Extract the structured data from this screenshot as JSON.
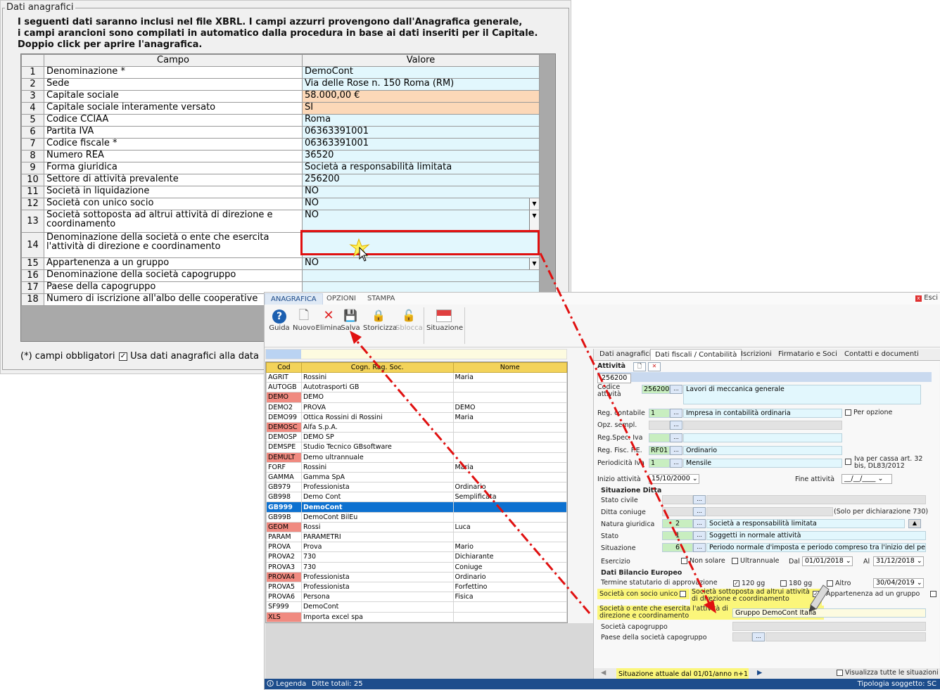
{
  "back": {
    "legend": "Dati anagrafici",
    "intro": [
      "I seguenti dati saranno inclusi nel file XBRL. I campi azzurri provengono dall'Anagrafica generale,",
      "i campi arancioni sono compilati in automatico dalla procedura in base ai dati inseriti per il Capitale.",
      "Doppio click per aprire l'anagrafica."
    ],
    "headers": {
      "campo": "Campo",
      "valore": "Valore"
    },
    "rows": [
      {
        "n": "1",
        "campo": "Denominazione *",
        "valore": "DemoCont"
      },
      {
        "n": "2",
        "campo": "Sede",
        "valore": "Via delle Rose n. 150 Roma (RM)"
      },
      {
        "n": "3",
        "campo": "Capitale sociale",
        "valore": "58.000,00 €"
      },
      {
        "n": "4",
        "campo": "Capitale sociale interamente versato",
        "valore": "SI"
      },
      {
        "n": "5",
        "campo": "Codice CCIAA",
        "valore": "Roma"
      },
      {
        "n": "6",
        "campo": "Partita IVA",
        "valore": "06363391001"
      },
      {
        "n": "7",
        "campo": "Codice fiscale *",
        "valore": "06363391001"
      },
      {
        "n": "8",
        "campo": "Numero REA",
        "valore": "36520"
      },
      {
        "n": "9",
        "campo": "Forma giuridica",
        "valore": "Società a responsabilità limitata"
      },
      {
        "n": "10",
        "campo": "Settore di attività prevalente",
        "valore": "256200"
      },
      {
        "n": "11",
        "campo": "Società in liquidazione",
        "valore": "NO"
      },
      {
        "n": "12",
        "campo": "Società con unico socio",
        "valore": "NO"
      },
      {
        "n": "13",
        "campo": "Società sottoposta ad altrui attività di direzione e coordinamento",
        "valore": "NO"
      },
      {
        "n": "14",
        "campo": "Denominazione della società o ente che esercita l'attività di direzione e coordinamento",
        "valore": ""
      },
      {
        "n": "15",
        "campo": "Appartenenza a un gruppo",
        "valore": "NO"
      },
      {
        "n": "16",
        "campo": "Denominazione della società capogruppo",
        "valore": ""
      },
      {
        "n": "17",
        "campo": "Paese della capogruppo",
        "valore": ""
      },
      {
        "n": "18",
        "campo": "Numero di iscrizione all'albo delle cooperative",
        "valore": ""
      }
    ],
    "footer_note": "(*) campi obbligatori",
    "usa_label": "Usa dati anagrafici alla data"
  },
  "front": {
    "tabs": [
      "ANAGRAFICA",
      "OPZIONI",
      "STAMPA"
    ],
    "esci": "Esci",
    "ribbon": [
      {
        "label": "Guida",
        "icon": "help-icon",
        "glyph": "?"
      },
      {
        "label": "Nuovo",
        "icon": "new-document-icon",
        "glyph": "🗋"
      },
      {
        "label": "Elimina",
        "icon": "delete-icon",
        "glyph": "✕"
      },
      {
        "label": "Salva",
        "icon": "save-icon",
        "glyph": "💾"
      },
      {
        "label": "Storicizza",
        "icon": "archive-lock-icon",
        "glyph": "🔒"
      },
      {
        "label": "Sblocca",
        "icon": "unlock-icon",
        "glyph": "🔓"
      },
      {
        "label": "Situazione",
        "icon": "situation-flag-icon",
        "glyph": "▬"
      }
    ],
    "list_headers": {
      "cod": "Cod",
      "cogn": "Cogn. Rag. Soc.",
      "nome": "Nome"
    },
    "list": [
      {
        "cod": "AGRIT",
        "cogn": "Rossini",
        "nome": "Maria",
        "red": false
      },
      {
        "cod": "AUTOGB",
        "cogn": "Autotrasporti GB",
        "nome": "",
        "red": false
      },
      {
        "cod": "DEMO",
        "cogn": "DEMO",
        "nome": "",
        "red": true
      },
      {
        "cod": "DEMO2",
        "cogn": "PROVA",
        "nome": "DEMO",
        "red": false
      },
      {
        "cod": "DEMO99",
        "cogn": "Ottica Rossini di Rossini",
        "nome": "Maria",
        "red": false
      },
      {
        "cod": "DEMOSC",
        "cogn": "Alfa S.p.A.",
        "nome": "",
        "red": true
      },
      {
        "cod": "DEMOSP",
        "cogn": "DEMO SP",
        "nome": "",
        "red": false
      },
      {
        "cod": "DEMSPE",
        "cogn": "Studio Tecnico GBsoftware",
        "nome": "",
        "red": false
      },
      {
        "cod": "DEMULT",
        "cogn": "Demo ultrannuale",
        "nome": "",
        "red": true
      },
      {
        "cod": "FORF",
        "cogn": "Rossini",
        "nome": "Maria",
        "red": false
      },
      {
        "cod": "GAMMA",
        "cogn": "Gamma SpA",
        "nome": "",
        "red": false
      },
      {
        "cod": "GB979",
        "cogn": "Professionista",
        "nome": "Ordinario",
        "red": false
      },
      {
        "cod": "GB998",
        "cogn": "Demo Cont",
        "nome": "Semplificata",
        "red": false
      },
      {
        "cod": "GB999",
        "cogn": "DemoCont",
        "nome": "",
        "red": false,
        "sel": true
      },
      {
        "cod": "GB99B",
        "cogn": "DemoCont BilEu",
        "nome": "",
        "red": false
      },
      {
        "cod": "GEOM",
        "cogn": "Rossi",
        "nome": "Luca",
        "red": true
      },
      {
        "cod": "PARAM",
        "cogn": "PARAMETRI",
        "nome": "",
        "red": false
      },
      {
        "cod": "PROVA",
        "cogn": "Prova",
        "nome": "Mario",
        "red": false
      },
      {
        "cod": "PROVA2",
        "cogn": "730",
        "nome": "Dichiarante",
        "red": false
      },
      {
        "cod": "PROVA3",
        "cogn": "730",
        "nome": "Coniuge",
        "red": false
      },
      {
        "cod": "PROVA4",
        "cogn": "Professionista",
        "nome": "Ordinario",
        "red": true
      },
      {
        "cod": "PROVA5",
        "cogn": "Professionista",
        "nome": "Forfettino",
        "red": false
      },
      {
        "cod": "PROVA6",
        "cogn": "Persona",
        "nome": "Fisica",
        "red": false
      },
      {
        "cod": "SF999",
        "cogn": "DemoCont",
        "nome": "",
        "red": false
      },
      {
        "cod": "XLS",
        "cogn": "Importa excel spa",
        "nome": "",
        "red": true
      }
    ],
    "status": {
      "legenda": "Legenda",
      "ditte": "Ditte totali: 25",
      "tipologia": "Tipologia soggetto: SC"
    },
    "panel_tabs": [
      "Dati anagrafici",
      "Dati fiscali / Contabilità",
      "Iscrizioni",
      "Firmatario e Soci",
      "Contatti e documenti"
    ],
    "attivita": {
      "title": "Attività",
      "code_tab": "256200",
      "codice_label": "Codice attività",
      "codice_code": "256200",
      "codice_desc": "Lavori di meccanica generale",
      "reg_contabile_label": "Reg. contabile",
      "reg_contabile_code": "1",
      "reg_contabile_desc": "Impresa  in contabilità ordinaria",
      "per_opzione": "Per opzione",
      "opz_label": "Opz. sempl.",
      "reg_spec_label": "Reg.Spec. Iva",
      "reg_fisc_label": "Reg. Fisc. F.E.",
      "reg_fisc_code": "RF01",
      "reg_fisc_desc": "Ordinario",
      "periodicita_label": "Periodicità Iva",
      "periodicita_code": "1",
      "periodicita_desc": "Mensile",
      "iva_cassa": "Iva per cassa art. 32 bis, DL83/2012",
      "inizio_label": "Inizio attività",
      "inizio_value": "15/10/2000",
      "fine_label": "Fine attività",
      "fine_value": "__/__/____"
    },
    "situazione": {
      "title": "Situazione Ditta",
      "stato_civile": "Stato civile",
      "ditta_coniuge": "Ditta coniuge",
      "solo_730": "(Solo per dichiarazione 730)",
      "natura_label": "Natura giuridica",
      "natura_code": "2",
      "natura_desc": "Società a responsabilità limitata",
      "stato_label": "Stato",
      "stato_code": "1",
      "stato_desc": "Soggetti in normale attività",
      "situazione_label": "Situazione",
      "situazione_code": "6",
      "situazione_desc": "Periodo normale d'imposta e periodo compreso tra l'inizio del period",
      "esercizio_label": "Esercizio",
      "non_solare": "Non solare",
      "ultrannuale": "Ultrannuale",
      "dal_label": "Dal",
      "dal_value": "01/01/2018",
      "al_label": "Al",
      "al_value": "31/12/2018"
    },
    "bilancio": {
      "title": "Dati Bilancio Europeo",
      "termine_label": "Termine statutario di approvazione",
      "g120": "120 gg",
      "g180": "180 gg",
      "altro": "Altro",
      "termine_date": "30/04/2019",
      "socio_unico": "Società con socio unico",
      "sottoposta": "Società sottoposta ad altrui attività di direzione e coordinamento",
      "appartenenza": "Appartenenza ad un gruppo",
      "ente_label": "Società o ente che esercita l'attività di direzione e coordinamento",
      "ente_value": "Gruppo DemoCont Italia",
      "capogruppo_label": "Società capogruppo",
      "paese_label": "Paese della società capogruppo"
    },
    "bottom": {
      "situazione_attuale": "Situazione attuale dal 01/01/anno n+1",
      "visualizza": "Visualizza tutte le situazioni"
    }
  },
  "colors": {
    "accent_red": "#e01010",
    "selection_blue": "#0d71d0",
    "light_blue": "#e2f7fd",
    "orange": "#fcd8b8",
    "yellow_highlight": "#fbf67a"
  }
}
